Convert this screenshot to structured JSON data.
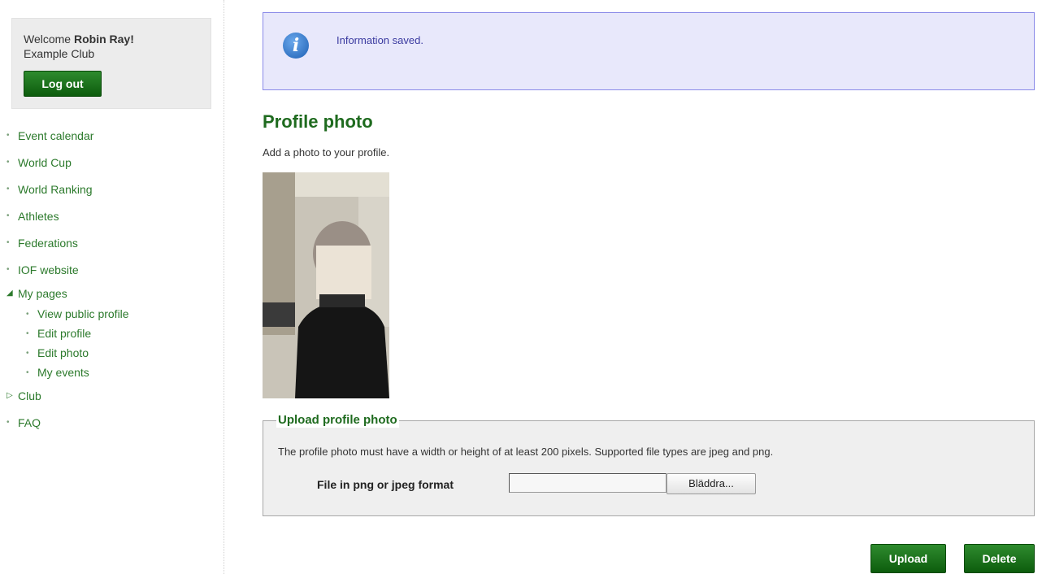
{
  "sidebar": {
    "welcome_prefix": "Welcome ",
    "user_name": "Robin Ray!",
    "club_name": "Example Club",
    "logout_label": "Log out",
    "nav": [
      {
        "label": "Event calendar"
      },
      {
        "label": "World Cup"
      },
      {
        "label": "World Ranking"
      },
      {
        "label": "Athletes"
      },
      {
        "label": "Federations"
      },
      {
        "label": "IOF website"
      }
    ],
    "my_pages": {
      "label": "My pages",
      "items": [
        {
          "label": "View public profile"
        },
        {
          "label": "Edit profile"
        },
        {
          "label": "Edit photo"
        },
        {
          "label": "My events"
        }
      ]
    },
    "club_label": "Club",
    "faq_label": "FAQ"
  },
  "info": {
    "icon": "info-icon",
    "message": "Information saved."
  },
  "main": {
    "title": "Profile photo",
    "description": "Add a photo to your profile."
  },
  "upload": {
    "legend": "Upload profile photo",
    "note": "The profile photo must have a width or height of at least 200 pixels. Supported file types are jpeg and png.",
    "file_label": "File in png or jpeg format",
    "file_value": "",
    "browse_label": "Bläddra..."
  },
  "actions": {
    "upload_label": "Upload",
    "delete_label": "Delete"
  },
  "colors": {
    "accent_green": "#1f6b1f",
    "info_bg": "#e8e8fb",
    "info_border": "#8a8ae8"
  }
}
